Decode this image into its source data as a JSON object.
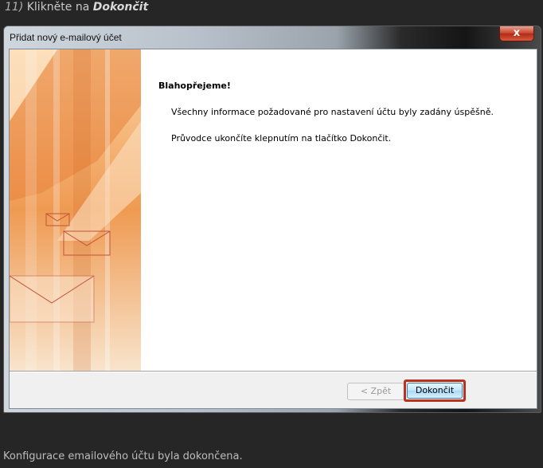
{
  "step": {
    "number": "11)",
    "text": " Klikněte na ",
    "target": "Dokončit"
  },
  "window": {
    "title": "Přidat nový e-mailový účet",
    "close_label": "x"
  },
  "content": {
    "heading": "Blahopřejeme!",
    "line1": "Všechny informace požadované pro nastavení účtu byly zadány úspěšně.",
    "line2": "Průvodce ukončíte klepnutím na tlačítko Dokončit."
  },
  "buttons": {
    "back": "< Zpět",
    "finish": "Dokončit"
  },
  "caption": "Konfigurace emailového účtu byla dokončena.",
  "colors": {
    "highlight": "#b8321d",
    "banner_orange": "#f19b4e"
  }
}
